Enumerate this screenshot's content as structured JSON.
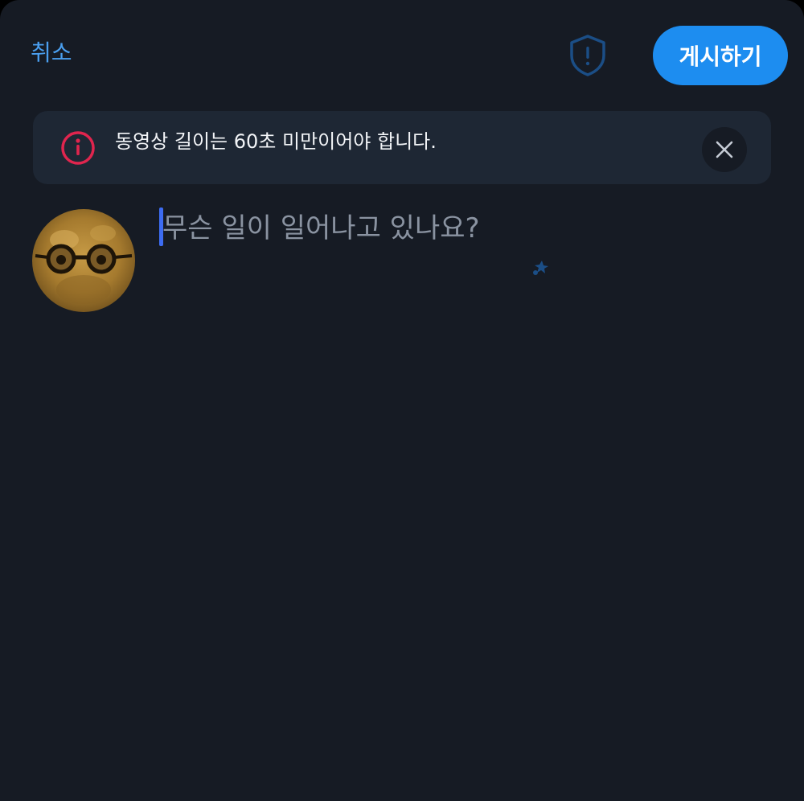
{
  "header": {
    "cancel_label": "취소",
    "post_label": "게시하기"
  },
  "alert": {
    "message": "동영상 길이는 60초 미만이어야 합니다."
  },
  "composer": {
    "placeholder": "무슨 일이 일어나고 있나요?"
  },
  "icons": {
    "shield": "shield-exclamation-icon",
    "alert": "info-circle-icon",
    "close": "close-icon"
  },
  "colors": {
    "background": "#161b24",
    "accent": "#1d8df0",
    "link": "#4a9fef",
    "alert_bg": "#1e2734",
    "alert_icon": "#e0254e",
    "placeholder": "#8a93a1"
  }
}
